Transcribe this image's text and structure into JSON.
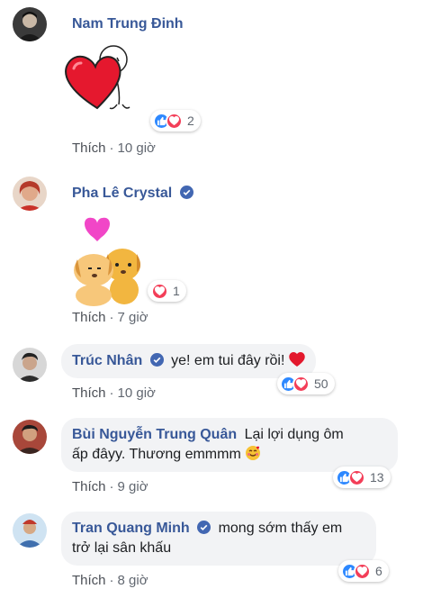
{
  "comments": [
    {
      "name": "Nam Trung Đinh",
      "verified": false,
      "text": "",
      "like_label": "Thích",
      "time": "10 giờ",
      "reaction_count": "2",
      "sticker": "heart-hug-sticker"
    },
    {
      "name": "Pha Lê Crystal",
      "verified": true,
      "text": "",
      "like_label": "Thích",
      "time": "7 giờ",
      "reaction_count": "1",
      "sticker": "puppies-love-sticker"
    },
    {
      "name": "Trúc Nhân",
      "verified": true,
      "text": "ye! em tui đây rồi!",
      "emoji": "❤️",
      "like_label": "Thích",
      "time": "10 giờ",
      "reaction_count": "50"
    },
    {
      "name": "Bùi Nguyễn Trung Quân",
      "verified": false,
      "text_line1": "Lại lợi dụng ôm",
      "text_line2": "ấp đâyy. Thương emmmm",
      "emoji": "🥰",
      "like_label": "Thích",
      "time": "9 giờ",
      "reaction_count": "13"
    },
    {
      "name": "Tran Quang Minh",
      "verified": true,
      "text_line1": "mong sớm thấy em",
      "text_line2": "trở lại sân khấu",
      "like_label": "Thích",
      "time": "8 giờ",
      "reaction_count": "6"
    }
  ],
  "colors": {
    "name": "#385898",
    "like": "#2d88ff",
    "love": "#f33e58",
    "bubble": "#f2f3f5"
  }
}
